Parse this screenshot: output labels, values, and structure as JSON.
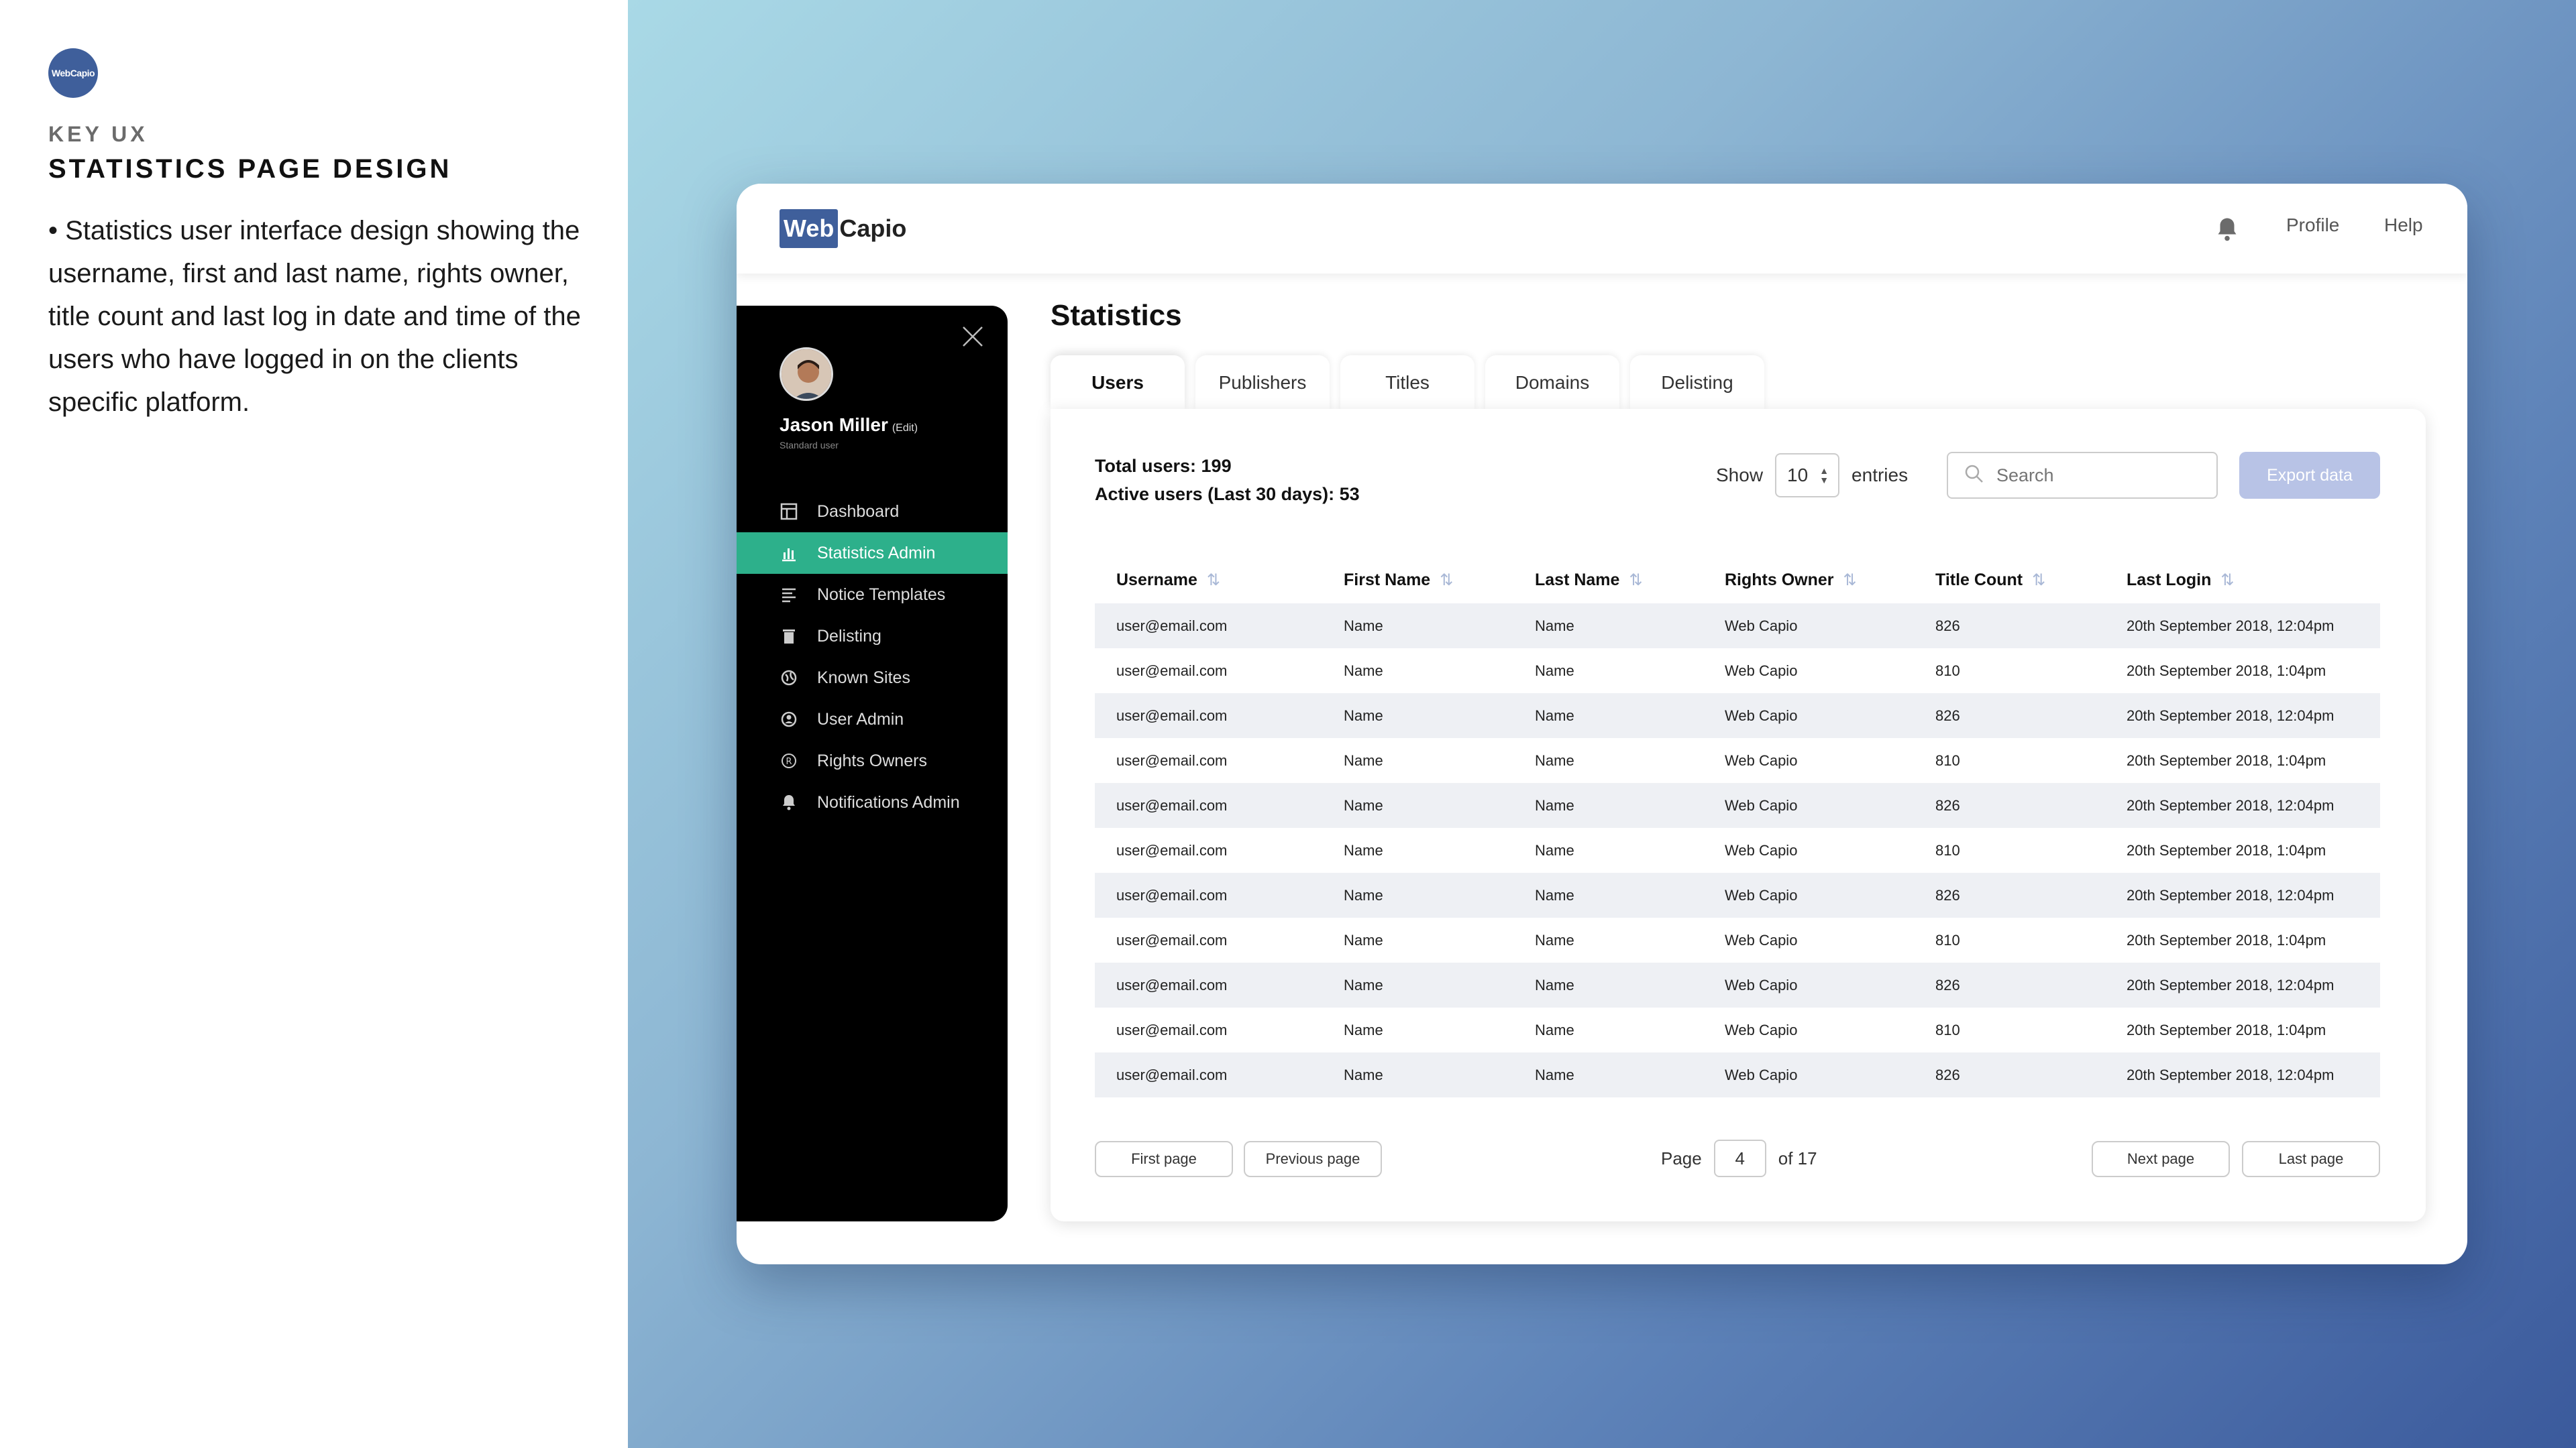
{
  "info": {
    "logo_text": "WebCapio",
    "kicker": "KEY UX",
    "heading": "STATISTICS PAGE DESIGN",
    "description": "• Statistics user interface design showing the username, first and last name, rights owner, title count and last log in date and time of the users who have logged in on the clients specific platform."
  },
  "header": {
    "brand_web": "Web",
    "brand_capio": "Capio",
    "profile_label": "Profile",
    "help_label": "Help",
    "notification_icon": "bell-icon"
  },
  "sidebar": {
    "user": {
      "name": "Jason Miller",
      "edit_label": "(Edit)",
      "role": "Standard user"
    },
    "items": [
      {
        "label": "Dashboard",
        "icon": "dashboard-icon",
        "active": false
      },
      {
        "label": "Statistics Admin",
        "icon": "bar-chart-icon",
        "active": true
      },
      {
        "label": "Notice Templates",
        "icon": "lines-icon",
        "active": false
      },
      {
        "label": "Delisting",
        "icon": "trash-icon",
        "active": false
      },
      {
        "label": "Known Sites",
        "icon": "globe-icon",
        "active": false
      },
      {
        "label": "User Admin",
        "icon": "user-icon",
        "active": false
      },
      {
        "label": "Rights Owners",
        "icon": "registered-icon",
        "active": false
      },
      {
        "label": "Notifications Admin",
        "icon": "bell-icon",
        "active": false
      }
    ]
  },
  "main": {
    "title": "Statistics",
    "tabs": [
      "Users",
      "Publishers",
      "Titles",
      "Domains",
      "Delisting"
    ],
    "active_tab": "Users",
    "total_users": "Total users: 199",
    "active_users": "Active users (Last 30 days): 53",
    "show_label": "Show",
    "entries_value": "10",
    "entries_label": "entries",
    "search_placeholder": "Search",
    "export_label": "Export data"
  },
  "table": {
    "columns": [
      "Username",
      "First Name",
      "Last Name",
      "Rights Owner",
      "Title Count",
      "Last Login"
    ],
    "rows": [
      [
        "user@email.com",
        "Name",
        "Name",
        "Web Capio",
        "826",
        "20th September 2018, 12:04pm"
      ],
      [
        "user@email.com",
        "Name",
        "Name",
        "Web Capio",
        "810",
        "20th September 2018, 1:04pm"
      ],
      [
        "user@email.com",
        "Name",
        "Name",
        "Web Capio",
        "826",
        "20th September 2018, 12:04pm"
      ],
      [
        "user@email.com",
        "Name",
        "Name",
        "Web Capio",
        "810",
        "20th September 2018, 1:04pm"
      ],
      [
        "user@email.com",
        "Name",
        "Name",
        "Web Capio",
        "826",
        "20th September 2018, 12:04pm"
      ],
      [
        "user@email.com",
        "Name",
        "Name",
        "Web Capio",
        "810",
        "20th September 2018, 1:04pm"
      ],
      [
        "user@email.com",
        "Name",
        "Name",
        "Web Capio",
        "826",
        "20th September 2018, 12:04pm"
      ],
      [
        "user@email.com",
        "Name",
        "Name",
        "Web Capio",
        "810",
        "20th September 2018, 1:04pm"
      ],
      [
        "user@email.com",
        "Name",
        "Name",
        "Web Capio",
        "826",
        "20th September 2018, 12:04pm"
      ],
      [
        "user@email.com",
        "Name",
        "Name",
        "Web Capio",
        "810",
        "20th September 2018, 1:04pm"
      ],
      [
        "user@email.com",
        "Name",
        "Name",
        "Web Capio",
        "826",
        "20th September 2018, 12:04pm"
      ]
    ]
  },
  "pagination": {
    "first_label": "First page",
    "previous_label": "Previous page",
    "page_label": "Page",
    "current_page": "4",
    "of_label": "of 17",
    "next_label": "Next page",
    "last_label": "Last page"
  },
  "colors": {
    "brand": "#3f5f9b",
    "active_nav": "#2db08b",
    "export_button": "#b8c3e6",
    "row_stripe": "#eef0f4"
  }
}
